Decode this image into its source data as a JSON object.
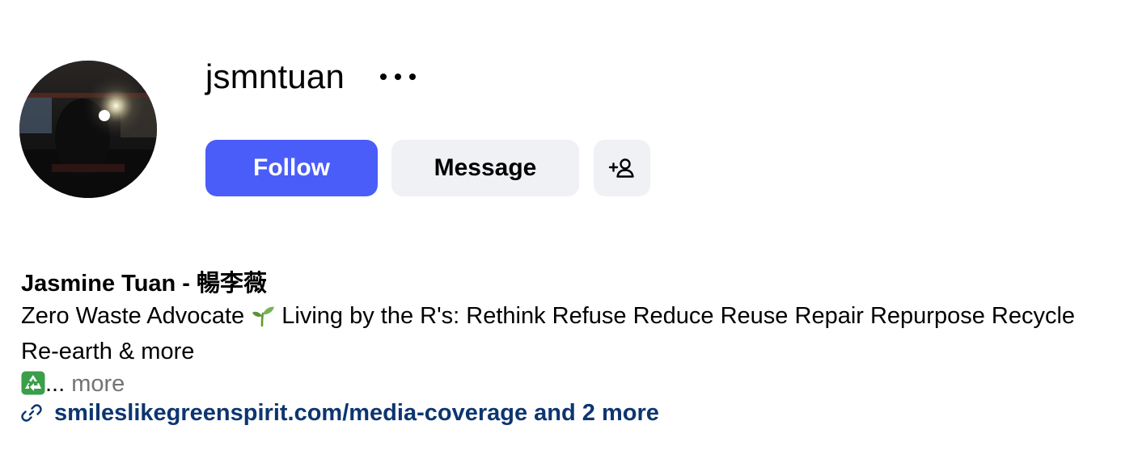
{
  "profile": {
    "username": "jsmntuan",
    "avatar_alt": "profile-picture",
    "more_options_icon": "ellipsis-horizontal-icon"
  },
  "actions": {
    "follow_label": "Follow",
    "message_label": "Message",
    "suggest_icon": "person-add-icon",
    "follow_color": "#4a5df9",
    "secondary_color": "#eff1f5"
  },
  "bio": {
    "full_name": "Jasmine Tuan - 暢李薇",
    "line1_before_emoji": "Zero Waste Advocate ",
    "line1_emoji": "seedling-icon",
    "line1_after_emoji": " Living by the R's: Rethink Refuse Reduce Reuse Repair Repurpose Recycle Re-earth & more",
    "line2_emoji": "recycle-icon",
    "ellipsis": "...",
    "more_label": " more"
  },
  "link": {
    "icon": "link-icon",
    "text": "smileslikegreenspirit.com/media-coverage and 2 more",
    "color": "#0d3570"
  }
}
